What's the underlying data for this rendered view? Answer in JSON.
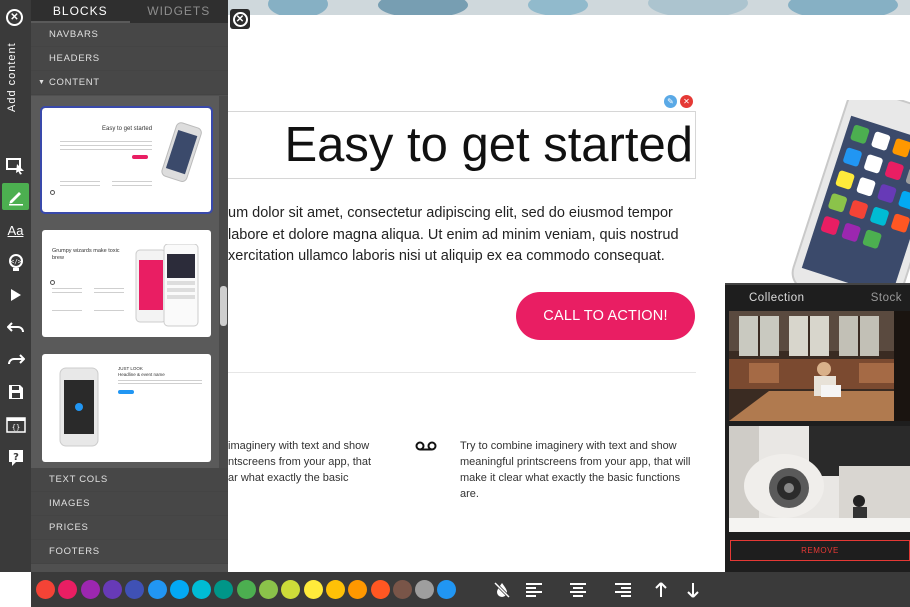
{
  "sidebar": {
    "vertical_label": "Add content",
    "tabs": [
      {
        "label": "BLOCKS",
        "active": true
      },
      {
        "label": "WIDGETS",
        "active": false
      }
    ],
    "categories_top": [
      "NAVBARS",
      "HEADERS",
      "CONTENT"
    ],
    "categories_bottom": [
      "TEXT COLS",
      "IMAGES",
      "PRICES",
      "FOOTERS"
    ],
    "thumbnails": [
      {
        "title": "Easy to get started",
        "selected": true
      },
      {
        "title": "Grumpy wizards make toxic brew",
        "selected": false
      },
      {
        "title": "JUST LOOK",
        "subtitle": "Headline & event name",
        "selected": false
      }
    ]
  },
  "canvas": {
    "headline": "Easy to get started",
    "lorem_lines": [
      "um dolor sit amet, consectetur adipiscing elit, sed do eiusmod tempor",
      "labore et dolore magna aliqua. Ut enim ad minim veniam, quis nostrud",
      "xercitation ullamco laboris nisi ut aliquip ex ea commodo consequat."
    ],
    "cta_label": "CALL TO ACTION!",
    "feature_left_lines": [
      "imaginery with text and show",
      "ntscreens from your app, that",
      "ar what exactly the basic"
    ],
    "feature_right": "Try to combine imaginery with text and show meaningful printscreens from your app, that will make it clear what exactly the basic functions are."
  },
  "media_panel": {
    "tabs": [
      "Collection",
      "Stock"
    ],
    "remove_label": "REMOVE"
  },
  "bottombar": {
    "colors": [
      "#f44336",
      "#e91e63",
      "#9c27b0",
      "#673ab7",
      "#3f51b5",
      "#2196f3",
      "#03a9f4",
      "#00bcd4",
      "#009688",
      "#4caf50",
      "#8bc34a",
      "#cddc39",
      "#ffeb3b",
      "#ffc107",
      "#ff9800",
      "#ff5722",
      "#795548",
      "#9e9e9e",
      "#2196f3"
    ]
  }
}
